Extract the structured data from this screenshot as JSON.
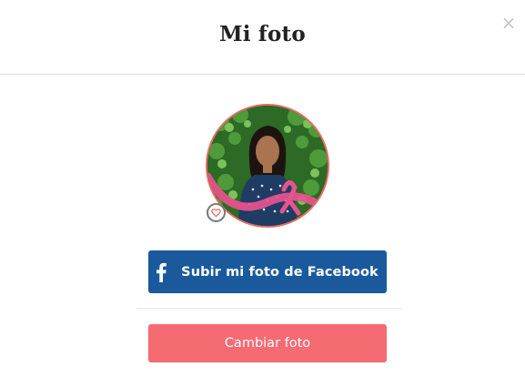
{
  "modal": {
    "title": "Mi foto",
    "close_symbol": "×"
  },
  "avatar": {
    "icon": "profile-photo",
    "badge_icon": "heart-icon"
  },
  "buttons": {
    "facebook_label": "Subir mi foto de Facebook",
    "facebook_icon": "facebook-icon",
    "change_label": "Cambiar foto"
  },
  "colors": {
    "facebook": "#1a5a9c",
    "change": "#f46b72",
    "avatar_border": "#e96b63"
  }
}
